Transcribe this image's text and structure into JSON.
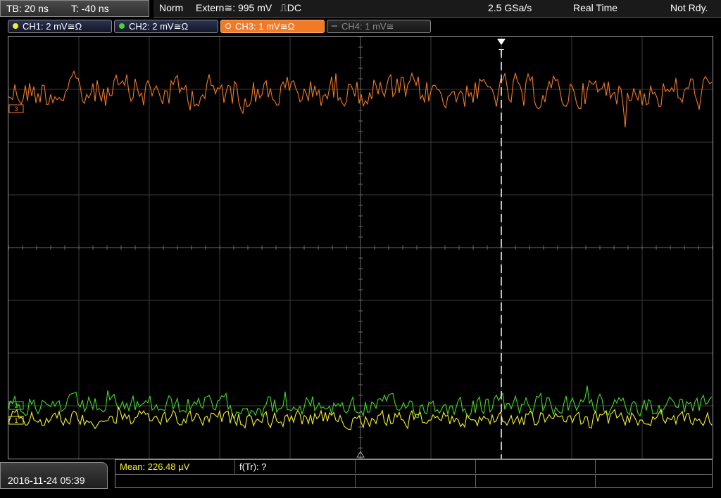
{
  "topbar": {
    "timebase": "TB: 20 ns",
    "trigger_offset": "T: -40 ns",
    "acq_mode": "Norm",
    "trigger_source": "Extern≅: 995 mV",
    "trigger_edge": "⎍DC",
    "sample_rate": "2.5 GSa/s",
    "mode": "Real Time",
    "state": "Not Rdy."
  },
  "channels": [
    {
      "label": "CH1: 2 mV≅Ω",
      "color": "#f4f02e",
      "active": false,
      "enabled": true
    },
    {
      "label": "CH2: 2 mV≅Ω",
      "color": "#44d829",
      "active": false,
      "enabled": true
    },
    {
      "label": "CH3: 1 mV≅Ω",
      "color": "#f07a28",
      "active": true,
      "enabled": true
    },
    {
      "label": "CH4: 1 mV≅",
      "color": "#666666",
      "active": false,
      "enabled": false
    }
  ],
  "markers": {
    "trigger_time_label": "T",
    "ch3_marker": "3",
    "ch2_marker": "2",
    "ch1_marker": "1"
  },
  "chart_data": {
    "type": "line",
    "x_divisions": 10,
    "y_divisions": 8,
    "trigger_position_div": 7,
    "grid": true,
    "series": [
      {
        "channel": "CH3",
        "color": "#f07a28",
        "offset_div": 6.95,
        "noise_div": 0.45
      },
      {
        "channel": "CH2",
        "color": "#44d829",
        "offset_div": 1.0,
        "noise_div": 0.28
      },
      {
        "channel": "CH1",
        "color": "#f4f02e",
        "offset_div": 0.75,
        "noise_div": 0.22
      }
    ]
  },
  "bottom": {
    "datetime": "2016-11-24 05:39",
    "measurements": [
      {
        "label": "Mean: 226.48 µV",
        "color": "#f4f02e"
      },
      {
        "label": "f(Tr): ?",
        "color": "#ffffff"
      }
    ]
  }
}
